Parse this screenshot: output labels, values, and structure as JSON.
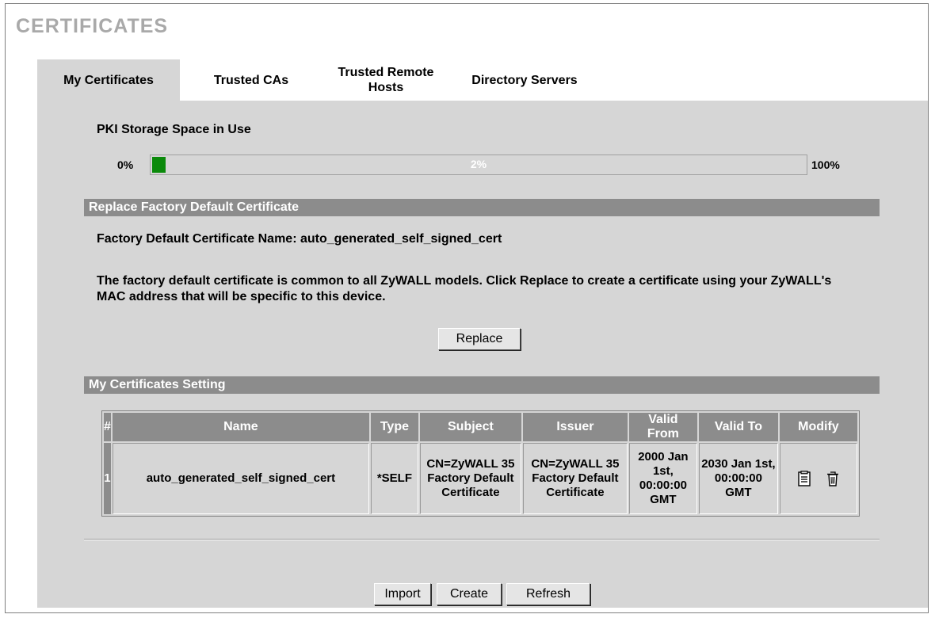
{
  "page": {
    "title": "CERTIFICATES"
  },
  "tabs": [
    {
      "label": "My Certificates",
      "active": true
    },
    {
      "label": "Trusted CAs",
      "active": false
    },
    {
      "label": "Trusted Remote Hosts",
      "active": false
    },
    {
      "label": "Directory Servers",
      "active": false
    }
  ],
  "pki": {
    "title": "PKI Storage Space in Use",
    "min_label": "0%",
    "max_label": "100%",
    "usage_text": "2%",
    "usage_fraction": 0.02,
    "bar_color": "#0b8a0b"
  },
  "replace_section": {
    "header": "Replace Factory Default Certificate",
    "name_line": "Factory Default Certificate Name: auto_generated_self_signed_cert",
    "description": "The factory default certificate is common to all ZyWALL models. Click Replace to create a certificate using your ZyWALL's MAC address that will be specific to this device.",
    "replace_button": "Replace"
  },
  "settings_section": {
    "header": "My Certificates Setting",
    "columns": {
      "index": "#",
      "name": "Name",
      "type": "Type",
      "subject": "Subject",
      "issuer": "Issuer",
      "valid_from": "Valid From",
      "valid_to": "Valid To",
      "modify": "Modify"
    },
    "rows": [
      {
        "index": "1",
        "name": "auto_generated_self_signed_cert",
        "type": "*SELF",
        "subject": "CN=ZyWALL 35 Factory Default Certificate",
        "issuer": "CN=ZyWALL 35 Factory Default Certificate",
        "valid_from": "2000 Jan 1st, 00:00:00 GMT",
        "valid_to": "2030 Jan 1st, 00:00:00 GMT",
        "icons": [
          "edit-details-icon",
          "trash-icon"
        ]
      }
    ]
  },
  "footer": {
    "import_button": "Import",
    "create_button": "Create",
    "refresh_button": "Refresh"
  }
}
